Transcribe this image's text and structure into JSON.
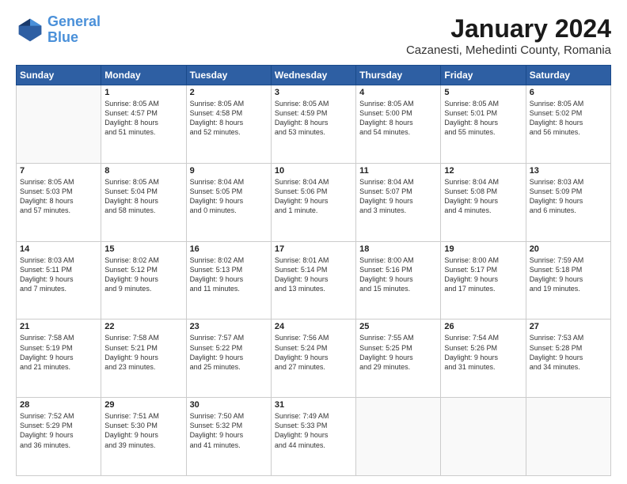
{
  "header": {
    "logo": {
      "line1": "General",
      "line2": "Blue"
    },
    "title": "January 2024",
    "subtitle": "Cazanesti, Mehedinti County, Romania"
  },
  "weekdays": [
    "Sunday",
    "Monday",
    "Tuesday",
    "Wednesday",
    "Thursday",
    "Friday",
    "Saturday"
  ],
  "weeks": [
    [
      {
        "day": "",
        "info": ""
      },
      {
        "day": "1",
        "info": "Sunrise: 8:05 AM\nSunset: 4:57 PM\nDaylight: 8 hours\nand 51 minutes."
      },
      {
        "day": "2",
        "info": "Sunrise: 8:05 AM\nSunset: 4:58 PM\nDaylight: 8 hours\nand 52 minutes."
      },
      {
        "day": "3",
        "info": "Sunrise: 8:05 AM\nSunset: 4:59 PM\nDaylight: 8 hours\nand 53 minutes."
      },
      {
        "day": "4",
        "info": "Sunrise: 8:05 AM\nSunset: 5:00 PM\nDaylight: 8 hours\nand 54 minutes."
      },
      {
        "day": "5",
        "info": "Sunrise: 8:05 AM\nSunset: 5:01 PM\nDaylight: 8 hours\nand 55 minutes."
      },
      {
        "day": "6",
        "info": "Sunrise: 8:05 AM\nSunset: 5:02 PM\nDaylight: 8 hours\nand 56 minutes."
      }
    ],
    [
      {
        "day": "7",
        "info": "Sunrise: 8:05 AM\nSunset: 5:03 PM\nDaylight: 8 hours\nand 57 minutes."
      },
      {
        "day": "8",
        "info": "Sunrise: 8:05 AM\nSunset: 5:04 PM\nDaylight: 8 hours\nand 58 minutes."
      },
      {
        "day": "9",
        "info": "Sunrise: 8:04 AM\nSunset: 5:05 PM\nDaylight: 9 hours\nand 0 minutes."
      },
      {
        "day": "10",
        "info": "Sunrise: 8:04 AM\nSunset: 5:06 PM\nDaylight: 9 hours\nand 1 minute."
      },
      {
        "day": "11",
        "info": "Sunrise: 8:04 AM\nSunset: 5:07 PM\nDaylight: 9 hours\nand 3 minutes."
      },
      {
        "day": "12",
        "info": "Sunrise: 8:04 AM\nSunset: 5:08 PM\nDaylight: 9 hours\nand 4 minutes."
      },
      {
        "day": "13",
        "info": "Sunrise: 8:03 AM\nSunset: 5:09 PM\nDaylight: 9 hours\nand 6 minutes."
      }
    ],
    [
      {
        "day": "14",
        "info": "Sunrise: 8:03 AM\nSunset: 5:11 PM\nDaylight: 9 hours\nand 7 minutes."
      },
      {
        "day": "15",
        "info": "Sunrise: 8:02 AM\nSunset: 5:12 PM\nDaylight: 9 hours\nand 9 minutes."
      },
      {
        "day": "16",
        "info": "Sunrise: 8:02 AM\nSunset: 5:13 PM\nDaylight: 9 hours\nand 11 minutes."
      },
      {
        "day": "17",
        "info": "Sunrise: 8:01 AM\nSunset: 5:14 PM\nDaylight: 9 hours\nand 13 minutes."
      },
      {
        "day": "18",
        "info": "Sunrise: 8:00 AM\nSunset: 5:16 PM\nDaylight: 9 hours\nand 15 minutes."
      },
      {
        "day": "19",
        "info": "Sunrise: 8:00 AM\nSunset: 5:17 PM\nDaylight: 9 hours\nand 17 minutes."
      },
      {
        "day": "20",
        "info": "Sunrise: 7:59 AM\nSunset: 5:18 PM\nDaylight: 9 hours\nand 19 minutes."
      }
    ],
    [
      {
        "day": "21",
        "info": "Sunrise: 7:58 AM\nSunset: 5:19 PM\nDaylight: 9 hours\nand 21 minutes."
      },
      {
        "day": "22",
        "info": "Sunrise: 7:58 AM\nSunset: 5:21 PM\nDaylight: 9 hours\nand 23 minutes."
      },
      {
        "day": "23",
        "info": "Sunrise: 7:57 AM\nSunset: 5:22 PM\nDaylight: 9 hours\nand 25 minutes."
      },
      {
        "day": "24",
        "info": "Sunrise: 7:56 AM\nSunset: 5:24 PM\nDaylight: 9 hours\nand 27 minutes."
      },
      {
        "day": "25",
        "info": "Sunrise: 7:55 AM\nSunset: 5:25 PM\nDaylight: 9 hours\nand 29 minutes."
      },
      {
        "day": "26",
        "info": "Sunrise: 7:54 AM\nSunset: 5:26 PM\nDaylight: 9 hours\nand 31 minutes."
      },
      {
        "day": "27",
        "info": "Sunrise: 7:53 AM\nSunset: 5:28 PM\nDaylight: 9 hours\nand 34 minutes."
      }
    ],
    [
      {
        "day": "28",
        "info": "Sunrise: 7:52 AM\nSunset: 5:29 PM\nDaylight: 9 hours\nand 36 minutes."
      },
      {
        "day": "29",
        "info": "Sunrise: 7:51 AM\nSunset: 5:30 PM\nDaylight: 9 hours\nand 39 minutes."
      },
      {
        "day": "30",
        "info": "Sunrise: 7:50 AM\nSunset: 5:32 PM\nDaylight: 9 hours\nand 41 minutes."
      },
      {
        "day": "31",
        "info": "Sunrise: 7:49 AM\nSunset: 5:33 PM\nDaylight: 9 hours\nand 44 minutes."
      },
      {
        "day": "",
        "info": ""
      },
      {
        "day": "",
        "info": ""
      },
      {
        "day": "",
        "info": ""
      }
    ]
  ]
}
